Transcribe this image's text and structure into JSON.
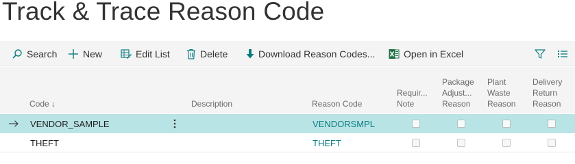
{
  "page": {
    "title": "Track & Trace Reason Code"
  },
  "toolbar": {
    "search": "Search",
    "new": "New",
    "edit_list": "Edit List",
    "delete": "Delete",
    "download": "Download Reason Codes...",
    "open_excel": "Open in Excel"
  },
  "columns": {
    "code": "Code",
    "sort_arrow": "↓",
    "description": "Description",
    "reason_code": "Reason Code",
    "require_note": [
      "Requir...",
      "Note"
    ],
    "package_adjust": [
      "Package",
      "Adjust...",
      "Reason"
    ],
    "plant_waste": [
      "Plant",
      "Waste",
      "Reason"
    ],
    "delivery_return": [
      "Delivery",
      "Return",
      "Reason"
    ]
  },
  "rows": [
    {
      "code": "VENDOR_SAMPLE",
      "description": "",
      "reason_code": "VENDORSMPL",
      "require_note": false,
      "package_adjust": false,
      "plant_waste": false,
      "delivery_return": false,
      "selected": true
    },
    {
      "code": "THEFT",
      "description": "",
      "reason_code": "THEFT",
      "require_note": false,
      "package_adjust": false,
      "plant_waste": false,
      "delivery_return": false,
      "selected": false
    }
  ],
  "colors": {
    "accent": "#0a7c80",
    "selected_row": "#b9e4e6",
    "excel_green": "#1e7145"
  }
}
